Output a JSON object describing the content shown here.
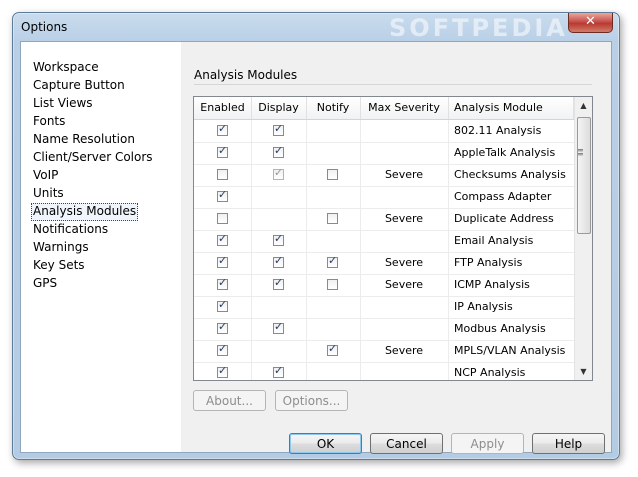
{
  "window": {
    "title": "Options",
    "watermark": "SOFTPEDIA",
    "close_glyph": "✕"
  },
  "nav": {
    "items": [
      {
        "label": "Workspace",
        "selected": false
      },
      {
        "label": "Capture Button",
        "selected": false
      },
      {
        "label": "List Views",
        "selected": false
      },
      {
        "label": "Fonts",
        "selected": false
      },
      {
        "label": "Name Resolution",
        "selected": false
      },
      {
        "label": "Client/Server Colors",
        "selected": false
      },
      {
        "label": "VoIP",
        "selected": false
      },
      {
        "label": "Units",
        "selected": false
      },
      {
        "label": "Analysis Modules",
        "selected": true
      },
      {
        "label": "Notifications",
        "selected": false
      },
      {
        "label": "Warnings",
        "selected": false
      },
      {
        "label": "Key Sets",
        "selected": false
      },
      {
        "label": "GPS",
        "selected": false
      }
    ]
  },
  "panel": {
    "title": "Analysis Modules",
    "columns": [
      "Enabled",
      "Display",
      "Notify",
      "Max Severity",
      "Analysis Module"
    ],
    "rows": [
      {
        "enabled": true,
        "display": true,
        "display_dim": false,
        "notify": null,
        "severity": "",
        "module": "802.11 Analysis"
      },
      {
        "enabled": true,
        "display": true,
        "display_dim": false,
        "notify": null,
        "severity": "",
        "module": "AppleTalk Analysis"
      },
      {
        "enabled": false,
        "display": true,
        "display_dim": true,
        "notify": false,
        "severity": "Severe",
        "module": "Checksums Analysis"
      },
      {
        "enabled": true,
        "display": null,
        "display_dim": false,
        "notify": null,
        "severity": "",
        "module": "Compass Adapter"
      },
      {
        "enabled": false,
        "display": null,
        "display_dim": false,
        "notify": false,
        "severity": "Severe",
        "module": "Duplicate Address"
      },
      {
        "enabled": true,
        "display": true,
        "display_dim": false,
        "notify": null,
        "severity": "",
        "module": "Email Analysis"
      },
      {
        "enabled": true,
        "display": true,
        "display_dim": false,
        "notify": true,
        "severity": "Severe",
        "module": "FTP Analysis"
      },
      {
        "enabled": true,
        "display": true,
        "display_dim": false,
        "notify": false,
        "severity": "Severe",
        "module": "ICMP Analysis"
      },
      {
        "enabled": true,
        "display": null,
        "display_dim": false,
        "notify": null,
        "severity": "",
        "module": "IP Analysis"
      },
      {
        "enabled": true,
        "display": true,
        "display_dim": false,
        "notify": null,
        "severity": "",
        "module": "Modbus Analysis"
      },
      {
        "enabled": true,
        "display": null,
        "display_dim": false,
        "notify": true,
        "severity": "Severe",
        "module": "MPLS/VLAN Analysis"
      },
      {
        "enabled": true,
        "display": true,
        "display_dim": false,
        "notify": null,
        "severity": "",
        "module": "NCP Analysis"
      }
    ],
    "about_label": "About...",
    "options_label": "Options..."
  },
  "footer": {
    "ok_label": "OK",
    "cancel_label": "Cancel",
    "apply_label": "Apply",
    "help_label": "Help"
  },
  "scrollbar": {
    "up_glyph": "▲",
    "down_glyph": "▼"
  }
}
